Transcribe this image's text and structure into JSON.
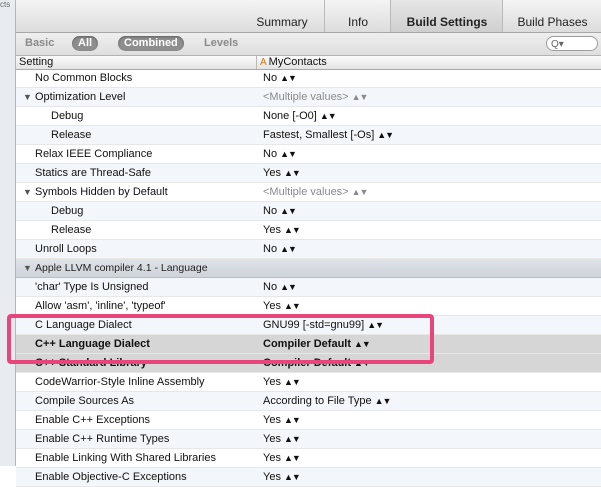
{
  "sidebar": {
    "text": "cts"
  },
  "tabs": [
    {
      "label": "Summary",
      "active": false
    },
    {
      "label": "Info",
      "active": false
    },
    {
      "label": "Build Settings",
      "active": true
    },
    {
      "label": "Build Phases",
      "active": false
    }
  ],
  "filters": {
    "basic": "Basic",
    "all": "All",
    "combined": "Combined",
    "levels": "Levels"
  },
  "search": {
    "placeholder": "Q▾"
  },
  "columns": {
    "setting": "Setting",
    "target": "MyContacts"
  },
  "rows": [
    {
      "name": "No Common Blocks",
      "value": "No"
    },
    {
      "name": "Optimization Level",
      "value": "<Multiple values>",
      "disclosure": true,
      "muted": true
    },
    {
      "name": "Debug",
      "value": "None [-O0]",
      "child": true
    },
    {
      "name": "Release",
      "value": "Fastest, Smallest [-Os]",
      "child": true
    },
    {
      "name": "Relax IEEE Compliance",
      "value": "No"
    },
    {
      "name": "Statics are Thread-Safe",
      "value": "Yes"
    },
    {
      "name": "Symbols Hidden by Default",
      "value": "<Multiple values>",
      "disclosure": true,
      "muted": true
    },
    {
      "name": "Debug",
      "value": "No",
      "child": true
    },
    {
      "name": "Release",
      "value": "Yes",
      "child": true
    },
    {
      "name": "Unroll Loops",
      "value": "No"
    },
    {
      "name": "Apple LLVM compiler 4.1 - Language",
      "value": "",
      "section": true
    },
    {
      "name": "'char' Type Is Unsigned",
      "value": "No"
    },
    {
      "name": "Allow 'asm', 'inline', 'typeof'",
      "value": "Yes"
    },
    {
      "name": "C Language Dialect",
      "value": "GNU99 [-std=gnu99]"
    },
    {
      "name": "C++ Language Dialect",
      "value": "Compiler Default",
      "highlight": true
    },
    {
      "name": "C++ Standard Library",
      "value": "Compiler Default",
      "highlight": true
    },
    {
      "name": "CodeWarrior-Style Inline Assembly",
      "value": "Yes"
    },
    {
      "name": "Compile Sources As",
      "value": "According to File Type"
    },
    {
      "name": "Enable C++ Exceptions",
      "value": "Yes"
    },
    {
      "name": "Enable C++ Runtime Types",
      "value": "Yes"
    },
    {
      "name": "Enable Linking With Shared Libraries",
      "value": "Yes"
    },
    {
      "name": "Enable Objective-C Exceptions",
      "value": "Yes"
    }
  ],
  "glyphs": {
    "stepper": "▲▼",
    "disclosure": "▼",
    "target_icon": "A"
  },
  "colors": {
    "callout": "#e7457c",
    "highlight_row": "#d6d6d6",
    "section_row": "#d7dbe0"
  }
}
